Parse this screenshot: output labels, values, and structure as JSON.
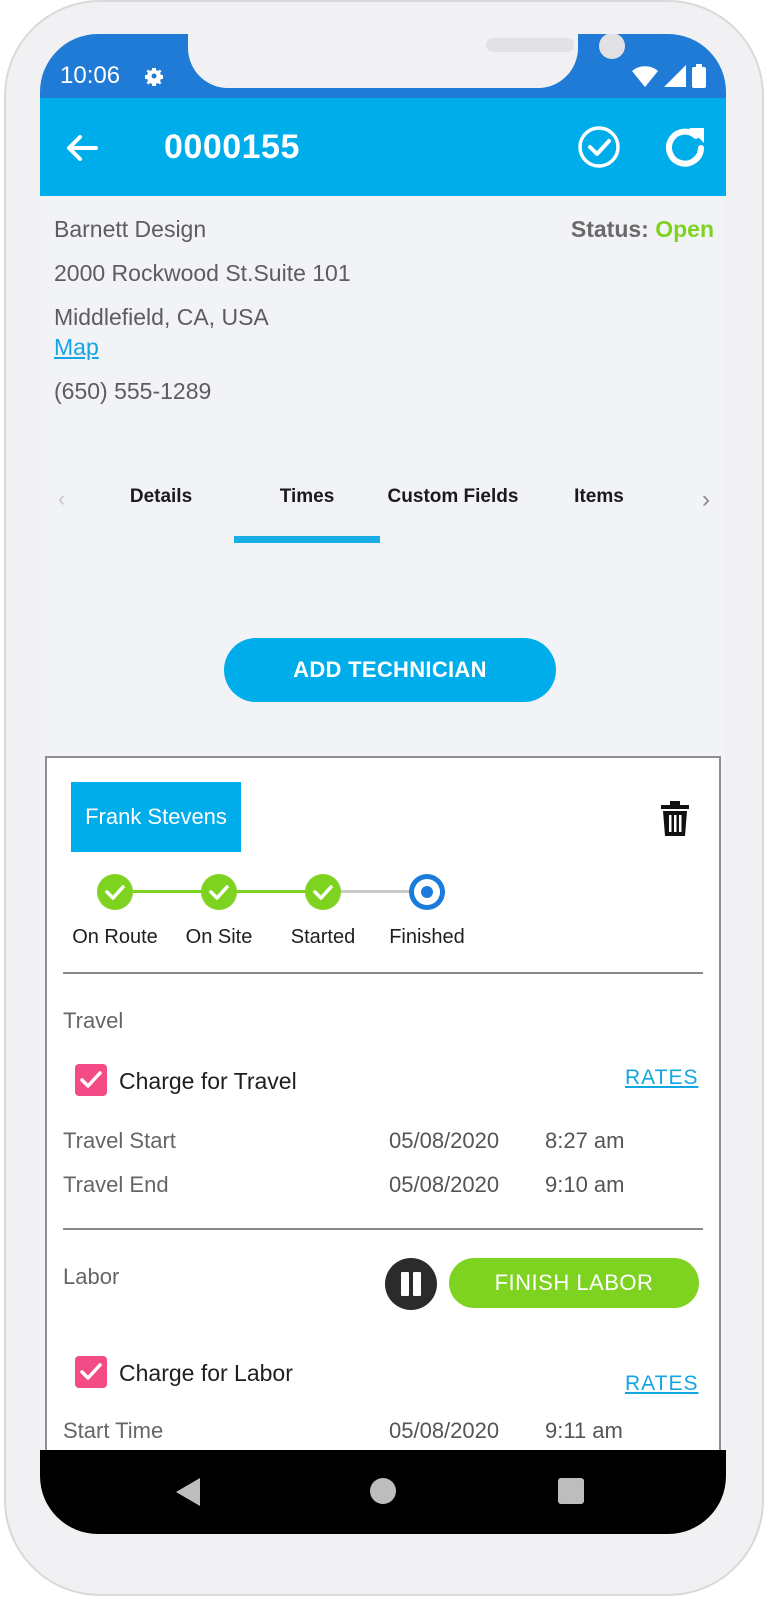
{
  "status_bar": {
    "time": "10:06"
  },
  "app_bar": {
    "title": "0000155"
  },
  "customer": {
    "name": "Barnett Design",
    "address_line1": "2000 Rockwood St.Suite 101",
    "address_line2": "Middlefield, CA, USA",
    "map_link": "Map",
    "phone": "(650) 555-1289",
    "status_label": "Status:",
    "status_value": "Open"
  },
  "tabs": [
    {
      "label": "Details"
    },
    {
      "label": "Times"
    },
    {
      "label": "Custom Fields"
    },
    {
      "label": "Items"
    }
  ],
  "active_tab": "Times",
  "add_technician_label": "ADD TECHNICIAN",
  "technician": {
    "name": "Frank Stevens",
    "steps": [
      {
        "label": "On Route",
        "state": "done"
      },
      {
        "label": "On Site",
        "state": "done"
      },
      {
        "label": "Started",
        "state": "done"
      },
      {
        "label": "Finished",
        "state": "current"
      }
    ],
    "travel": {
      "title": "Travel",
      "charge_label": "Charge for Travel",
      "charge_checked": true,
      "rates_label": "RATES",
      "rows": [
        {
          "label": "Travel Start",
          "date": "05/08/2020",
          "time": "8:27 am"
        },
        {
          "label": "Travel End",
          "date": "05/08/2020",
          "time": "9:10 am"
        }
      ]
    },
    "labor": {
      "title": "Labor",
      "finish_label": "FINISH LABOR",
      "charge_label": "Charge for Labor",
      "charge_checked": true,
      "rates_label": "RATES",
      "rows": [
        {
          "label": "Start Time",
          "date": "05/08/2020",
          "time": "9:11 am"
        }
      ]
    }
  },
  "colors": {
    "primary": "#00adeb",
    "status_bar": "#1f7bd6",
    "success": "#7ed321",
    "checkbox": "#f24b86",
    "link": "#14a5e3"
  }
}
